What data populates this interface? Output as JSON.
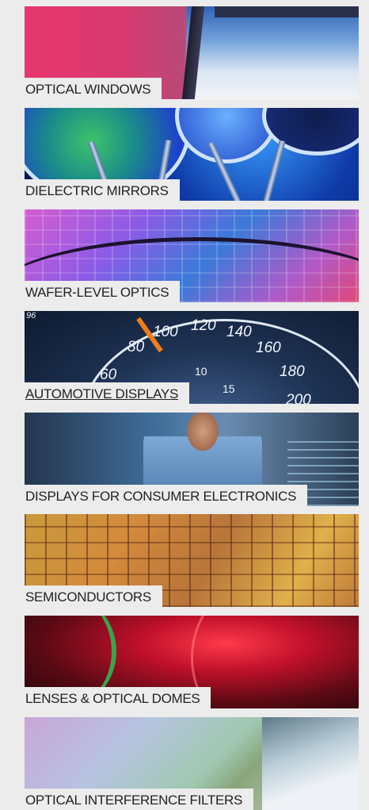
{
  "categories": [
    {
      "label": "OPTICAL WINDOWS",
      "image_icon": "optical-windows-photo"
    },
    {
      "label": "DIELECTRIC MIRRORS",
      "image_icon": "dielectric-mirrors-photo"
    },
    {
      "label": "WAFER-LEVEL OPTICS",
      "image_icon": "wafer-level-optics-photo"
    },
    {
      "label": "AUTOMOTIVE DISPLAYS",
      "image_icon": "speedometer-photo",
      "gauge_numbers": [
        "96",
        "80",
        "100",
        "120",
        "140",
        "160",
        "180",
        "60",
        "10",
        "15",
        "200"
      ]
    },
    {
      "label": "DISPLAYS FOR CONSUMER ELECTRONICS",
      "image_icon": "consumer-displays-photo"
    },
    {
      "label": "SEMICONDUCTORS",
      "image_icon": "semiconductor-wafer-photo"
    },
    {
      "label": "LENSES & OPTICAL DOMES",
      "image_icon": "red-lens-photo"
    },
    {
      "label": "OPTICAL INTERFERENCE FILTERS",
      "image_icon": "interference-filters-photo"
    }
  ]
}
